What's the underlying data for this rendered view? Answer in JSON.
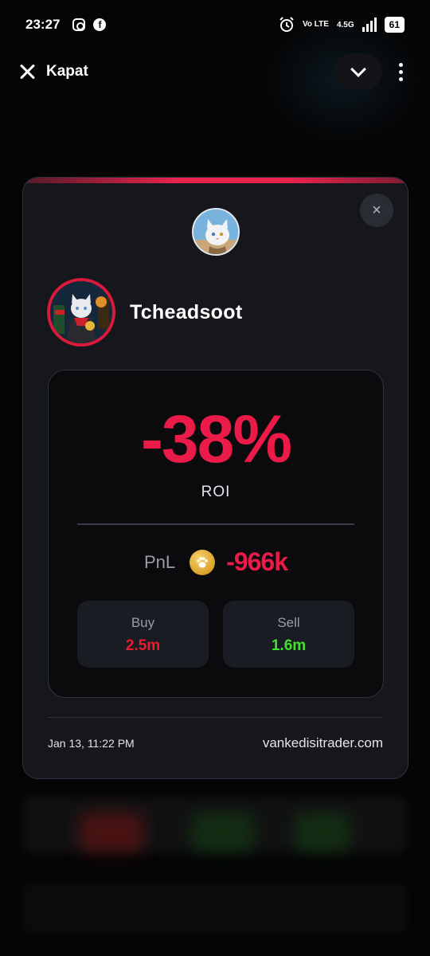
{
  "status_bar": {
    "time": "23:27",
    "network": "Vo LTE",
    "speed": "4.5G",
    "battery": "61"
  },
  "header": {
    "close_label": "Kapat"
  },
  "card": {
    "close_symbol": "×",
    "username": "Tcheadsoot",
    "roi_value": "-38%",
    "roi_label": "ROI",
    "pnl_label": "PnL",
    "pnl_value": "-966k",
    "buy_label": "Buy",
    "buy_value": "2.5m",
    "sell_label": "Sell",
    "sell_value": "1.6m",
    "date": "Jan 13, 11:22 PM",
    "site": "vankedisitrader.com"
  },
  "colors": {
    "accent_red": "#ea1b48",
    "buy_red": "#ea1b2c",
    "sell_green": "#43e030",
    "card_bg": "#16171c"
  }
}
